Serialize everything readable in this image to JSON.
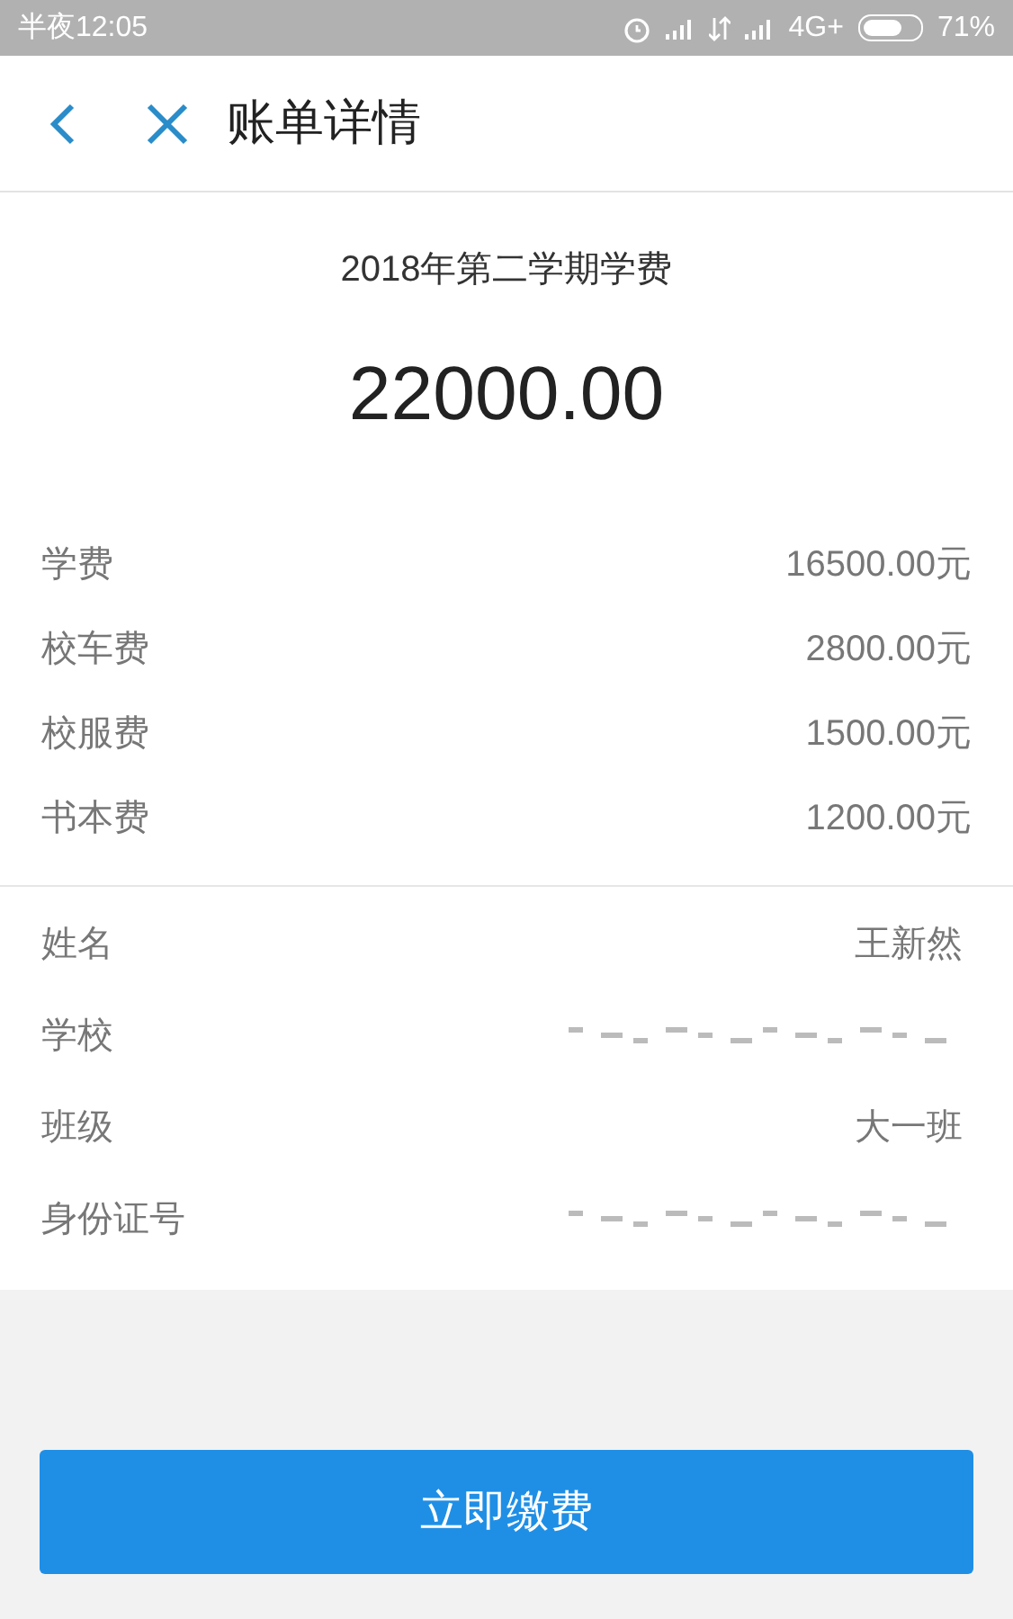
{
  "status_bar": {
    "time": "半夜12:05",
    "network": "4G+",
    "battery": "71%"
  },
  "header": {
    "title": "账单详情"
  },
  "bill": {
    "title": "2018年第二学期学费",
    "amount": "22000.00"
  },
  "fees": [
    {
      "label": "学费",
      "value": "16500.00元"
    },
    {
      "label": "校车费",
      "value": "2800.00元"
    },
    {
      "label": "校服费",
      "value": "1500.00元"
    },
    {
      "label": "书本费",
      "value": "1200.00元"
    }
  ],
  "info": [
    {
      "label": "姓名",
      "kind": "text",
      "value": "王新然"
    },
    {
      "label": "学校",
      "kind": "redacted"
    },
    {
      "label": "班级",
      "kind": "text",
      "value": "大一班"
    },
    {
      "label": "身份证号",
      "kind": "redacted"
    }
  ],
  "pay_button": "立即缴费"
}
